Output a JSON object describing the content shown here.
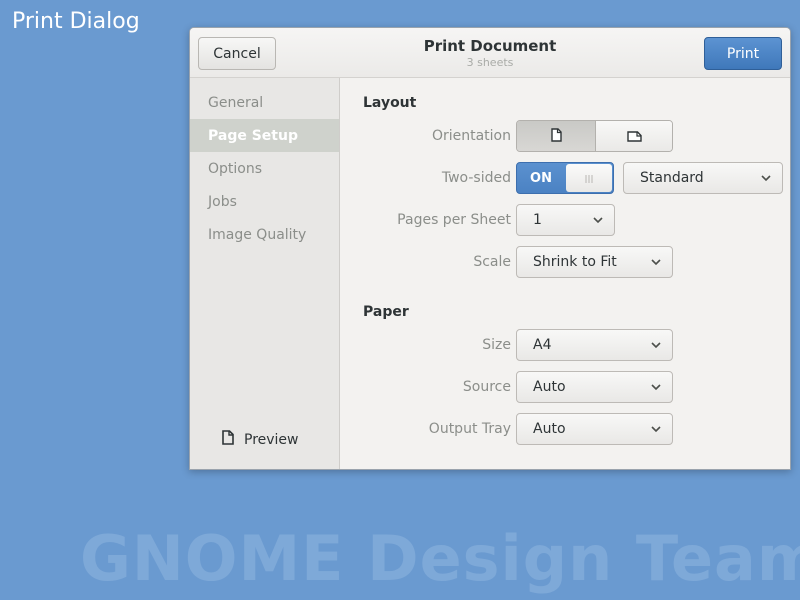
{
  "desktop": {
    "title": "Print Dialog",
    "watermark": "GNOME Design Team"
  },
  "header": {
    "cancel_label": "Cancel",
    "title": "Print Document",
    "subtitle": "3 sheets",
    "print_label": "Print"
  },
  "sidebar": {
    "items": [
      {
        "label": "General",
        "active": false
      },
      {
        "label": "Page Setup",
        "active": true
      },
      {
        "label": "Options",
        "active": false
      },
      {
        "label": "Jobs",
        "active": false
      },
      {
        "label": "Image Quality",
        "active": false
      }
    ],
    "preview_label": "Preview"
  },
  "layout": {
    "section_title": "Layout",
    "orientation_label": "Orientation",
    "orientation_selected": "portrait",
    "two_sided_label": "Two-sided",
    "two_sided_state": "ON",
    "two_sided_mode": "Standard",
    "pages_per_sheet_label": "Pages per Sheet",
    "pages_per_sheet_value": "1",
    "scale_label": "Scale",
    "scale_value": "Shrink to Fit"
  },
  "paper": {
    "section_title": "Paper",
    "size_label": "Size",
    "size_value": "A4",
    "source_label": "Source",
    "source_value": "Auto",
    "output_tray_label": "Output Tray",
    "output_tray_value": "Auto"
  },
  "colors": {
    "desktop_bg": "#6a9ad0",
    "accent": "#4a82c3",
    "dialog_bg": "#f3f2f0",
    "sidebar_bg": "#e8e7e5"
  }
}
